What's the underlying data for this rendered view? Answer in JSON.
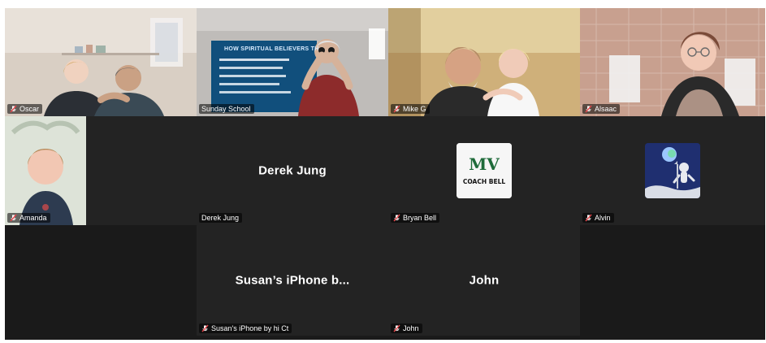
{
  "participants": [
    {
      "id": "oscar",
      "label": "Oscar"
    },
    {
      "id": "sunday_school",
      "label": "Sunday School",
      "slide_title": "HOW SPIRITUAL BELIEVERS TH"
    },
    {
      "id": "mike_g",
      "label": "Mike G"
    },
    {
      "id": "alsaac",
      "label": "Alsaac"
    },
    {
      "id": "amanda",
      "label": "Amanda"
    },
    {
      "id": "derek_jung",
      "label": "Derek Jung",
      "display_name": "Derek Jung"
    },
    {
      "id": "bryan_bell",
      "label": "Bryan Bell",
      "avatar_text_top": "MV",
      "avatar_text_bottom": "COACH BELL"
    },
    {
      "id": "alvin",
      "label": "Alvin"
    },
    {
      "id": "susans_iphone",
      "label": "Susan's iPhone by hi Ct",
      "display_name": "Susan’s iPhone b..."
    },
    {
      "id": "john",
      "label": "John",
      "display_name": "John"
    }
  ],
  "colors": {
    "stage_bg": "#1a1a1a",
    "tile_bg": "#232323",
    "active_speaker": "#22c55e",
    "mute_red": "#e5484d"
  }
}
